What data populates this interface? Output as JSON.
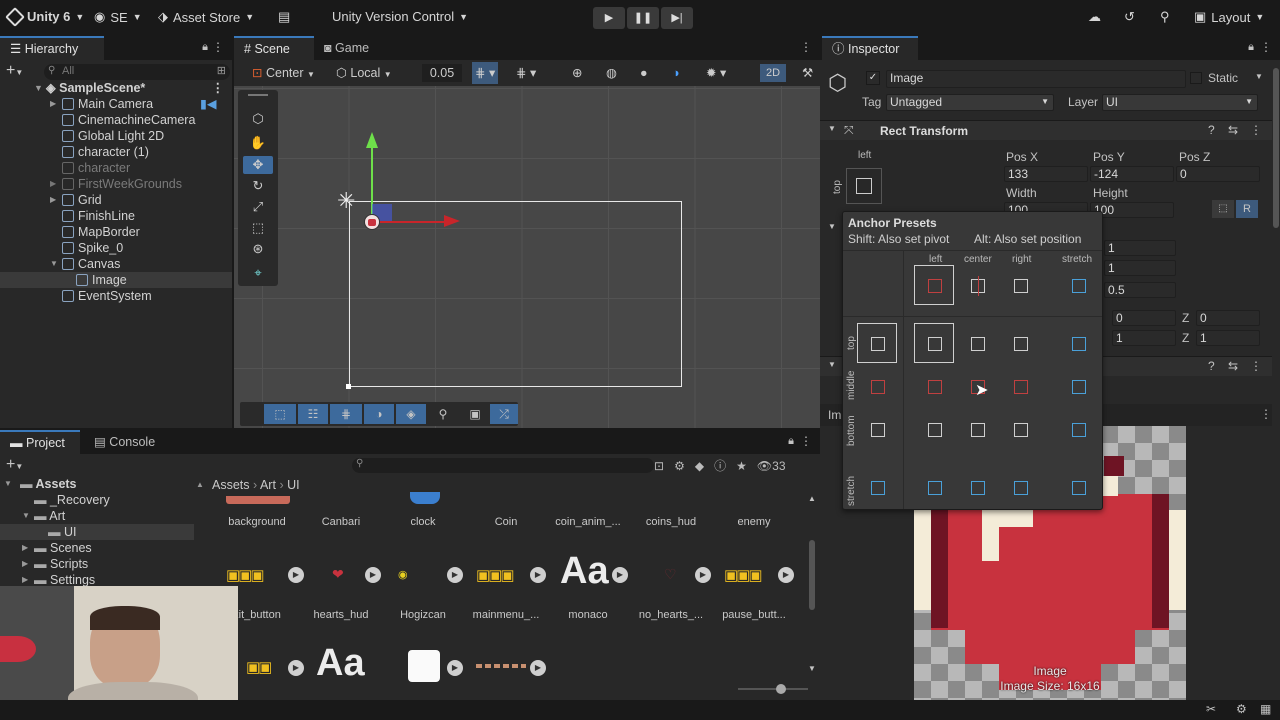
{
  "topbar": {
    "unity_version": "Unity 6",
    "account": "SE",
    "asset_store": "Asset Store",
    "version_control": "Unity Version Control",
    "layout": "Layout"
  },
  "hierarchy": {
    "tab": "Hierarchy",
    "search_placeholder": "All",
    "scene": "SampleScene*",
    "items": [
      {
        "label": "Main Camera"
      },
      {
        "label": "CinemachineCamera"
      },
      {
        "label": "Global Light 2D"
      },
      {
        "label": "character (1)"
      },
      {
        "label": "character"
      },
      {
        "label": "FirstWeekGrounds"
      },
      {
        "label": "Grid"
      },
      {
        "label": "FinishLine"
      },
      {
        "label": "MapBorder"
      },
      {
        "label": "Spike_0"
      },
      {
        "label": "Canvas"
      },
      {
        "label": "Image"
      },
      {
        "label": "EventSystem"
      }
    ]
  },
  "scene": {
    "tab_scene": "Scene",
    "tab_game": "Game",
    "pivot": "Center",
    "space": "Local",
    "snap": "0.05",
    "mode_2d": "2D"
  },
  "project": {
    "tab_project": "Project",
    "tab_console": "Console",
    "count": "33",
    "breadcrumb": [
      "Assets",
      "Art",
      "UI"
    ],
    "tree": [
      "Assets",
      "_Recovery",
      "Art",
      "UI",
      "Scenes",
      "Scripts",
      "Settings"
    ],
    "assets_row1": [
      "background",
      "Canbari",
      "clock",
      "Coin",
      "coin_anim_...",
      "coins_hud",
      "enemy"
    ],
    "assets_row2": [
      "xit_button",
      "hearts_hud",
      "Hogizcan",
      "mainmenu_...",
      "monaco",
      "no_hearts_...",
      "pause_butt..."
    ],
    "font_glyph": "Aa"
  },
  "inspector": {
    "tab": "Inspector",
    "object_name": "Image",
    "static": "Static",
    "tag_label": "Tag",
    "tag": "Untagged",
    "layer_label": "Layer",
    "layer": "UI",
    "component": "Rect Transform",
    "anchor_h": "left",
    "anchor_v": "top",
    "posx_label": "Pos X",
    "posy_label": "Pos Y",
    "posz_label": "Pos Z",
    "posx": "133",
    "posy": "-124",
    "posz": "0",
    "width_label": "Width",
    "height_label": "Height",
    "width": "100",
    "height": "100",
    "r_button": "R",
    "v1": "1",
    "v2": "1",
    "v3": "0.5",
    "x0": "0",
    "z_label": "Z",
    "z0": "0",
    "x1": "1",
    "z1": "1",
    "preview_title": "Image",
    "image_size": "Image Size: 16x16",
    "img_label": "Im"
  },
  "anchor_presets": {
    "title": "Anchor Presets",
    "hint_shift": "Shift: Also set pivot",
    "hint_alt": "Alt: Also set position",
    "columns": [
      "left",
      "center",
      "right",
      "stretch"
    ],
    "rows": [
      "top",
      "middle",
      "bottom",
      "stretch"
    ]
  },
  "colors": {
    "accent": "#3a79bb",
    "heart": "#c8323e",
    "panel": "#282828"
  }
}
